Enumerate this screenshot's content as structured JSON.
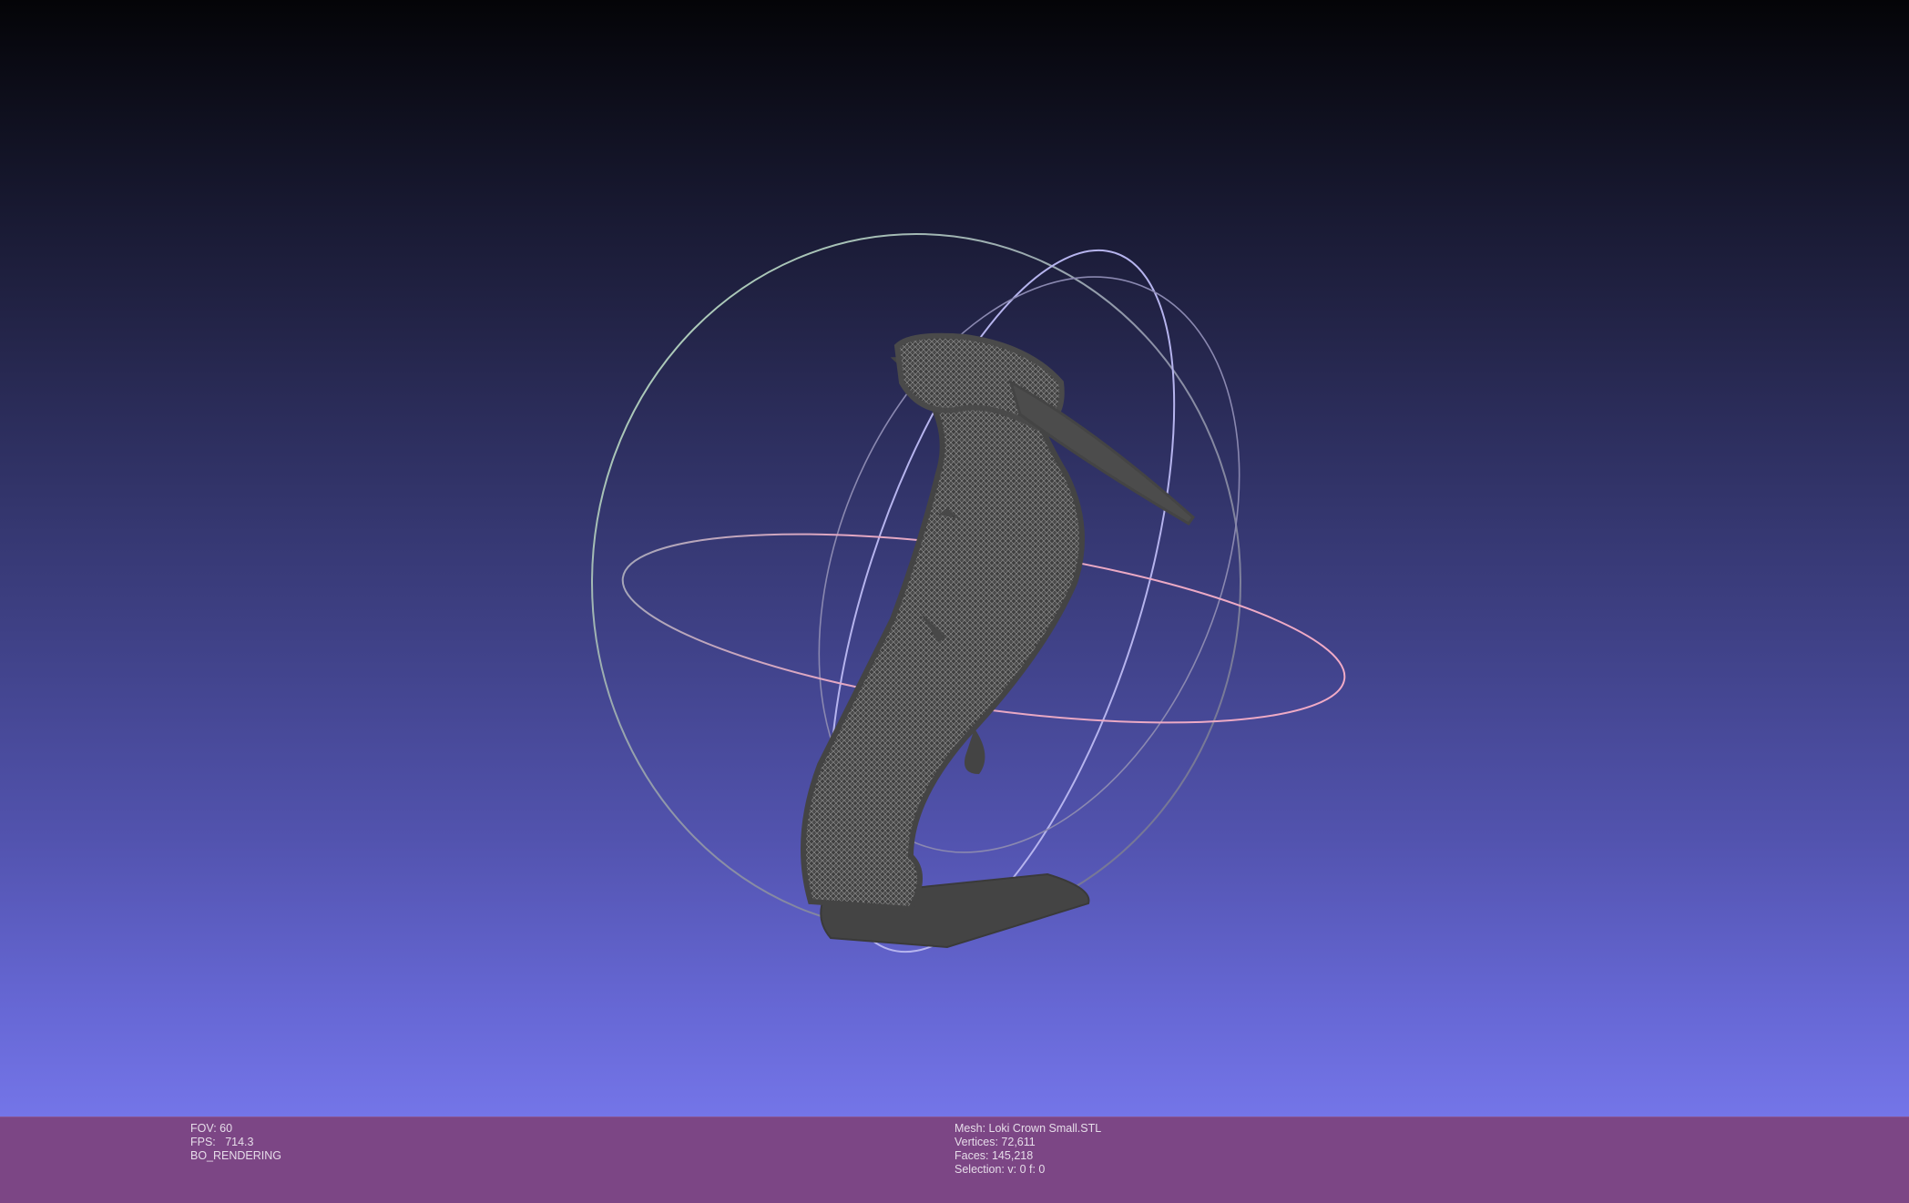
{
  "viewer": {
    "background_top_color": "#040407",
    "background_bottom_color": "#7475e8",
    "status_bar_color": "#7c4685",
    "mesh_color": "#4a4a4a",
    "trackball_x_color": "#e8a0b8",
    "trackball_y_color": "#a7a5f0",
    "trackball_z_color": "#a8d8b0"
  },
  "status_left": {
    "fov": "FOV: 60",
    "fps": "FPS:   714.3",
    "mode": "BO_RENDERING"
  },
  "status_right": {
    "mesh": "Mesh: Loki Crown Small.STL",
    "vertices": "Vertices: 72,611",
    "faces": "Faces: 145,218",
    "selection": "Selection: v: 0 f: 0"
  },
  "icons": {
    "model": "mesh-model-icon",
    "trackball": "trackball-gizmo-icon"
  }
}
